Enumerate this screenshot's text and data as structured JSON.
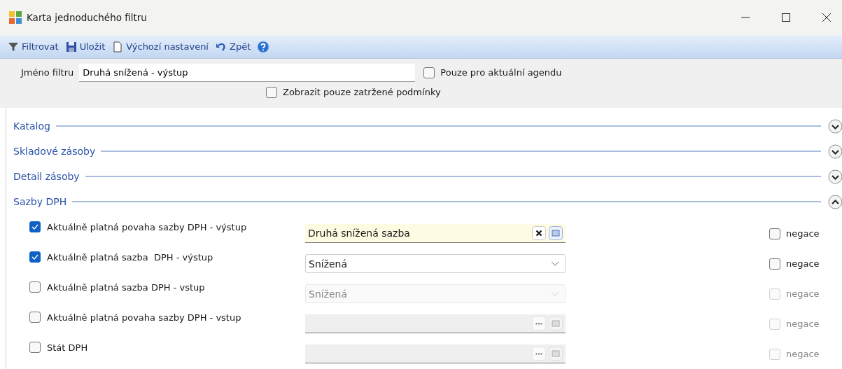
{
  "window": {
    "title": "Karta jednoduchého filtru"
  },
  "toolbar": [
    {
      "kind": "filter",
      "label": "Filtrovat"
    },
    {
      "kind": "save",
      "label": "Uložit"
    },
    {
      "kind": "page",
      "label": "Výchozí nastavení"
    },
    {
      "kind": "undo",
      "label": "Zpět"
    },
    {
      "kind": "help"
    }
  ],
  "filter_name": {
    "label": "Jméno filtru",
    "value": "Druhá snížená - výstup"
  },
  "only_current_agenda": {
    "label": "Pouze pro aktuální agendu",
    "checked": false
  },
  "only_checked_conditions": {
    "label": "Zobrazit pouze zatržené podmínky",
    "checked": false
  },
  "sections": [
    {
      "title": "Katalog",
      "expanded": false
    },
    {
      "title": "Skladové zásoby",
      "expanded": false
    },
    {
      "title": "Detail zásoby",
      "expanded": false
    },
    {
      "title": "Sazby DPH",
      "expanded": true,
      "conditions": [
        {
          "label": "Aktuálně platná povaha sazby DPH - výstup",
          "checked": true,
          "field": {
            "kind": "lookup",
            "value": "Druhá snížená sazba",
            "disabled": false
          },
          "negation": {
            "label": "negace",
            "checked": false,
            "disabled": false
          }
        },
        {
          "label": "Aktuálně platná sazba  DPH - výstup",
          "checked": true,
          "field": {
            "kind": "combo",
            "value": "Snížená",
            "disabled": false
          },
          "negation": {
            "label": "negace",
            "checked": false,
            "disabled": false
          }
        },
        {
          "label": "Aktuálně platná sazba DPH - vstup",
          "checked": false,
          "field": {
            "kind": "combo",
            "value": "Snížená",
            "disabled": true
          },
          "negation": {
            "label": "negace",
            "checked": false,
            "disabled": true
          }
        },
        {
          "label": "Aktuálně platná povaha sazby DPH - vstup",
          "checked": false,
          "field": {
            "kind": "lookup",
            "disabled": true
          },
          "negation": {
            "label": "negace",
            "checked": false,
            "disabled": true
          }
        },
        {
          "label": "Stát DPH",
          "checked": false,
          "field": {
            "kind": "lookup",
            "disabled": true
          },
          "negation": {
            "label": "negace",
            "checked": false,
            "disabled": true
          }
        }
      ]
    }
  ]
}
